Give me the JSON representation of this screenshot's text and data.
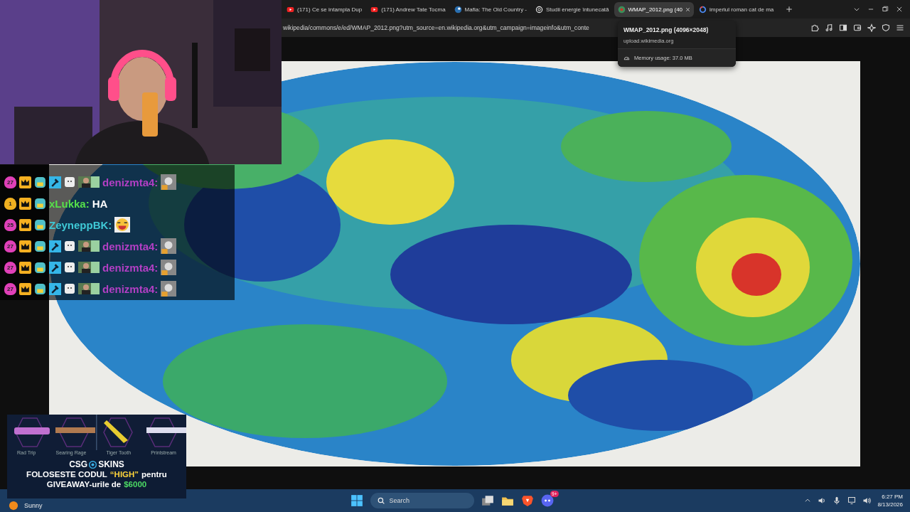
{
  "browser": {
    "tabs": [
      {
        "title": "(171) Ce se intampla Dup",
        "kind": "youtube",
        "selected": false
      },
      {
        "title": "(171) Andrew Tate Tocma",
        "kind": "youtube",
        "selected": false
      },
      {
        "title": "Mafia: The Old Country -",
        "kind": "steam",
        "selected": false
      },
      {
        "title": "Studii energie întunecată",
        "kind": "chat",
        "selected": false
      },
      {
        "title": "WMAP_2012.png (40",
        "kind": "wiki",
        "selected": true
      },
      {
        "title": "imperiul roman cat de ma",
        "kind": "google",
        "selected": false
      }
    ],
    "address": "wikipedia/commons/e/ed/WMAP_2012.png?utm_source=en.wikipedia.org&utm_campaign=imageinfo&utm_conte",
    "tooltip": {
      "title": "WMAP_2012.png (4096×2048)",
      "host": "upload.wikimedia.org",
      "memory": "Memory usage: 37.0 MB"
    }
  },
  "chat": [
    {
      "kind": "mod",
      "badge": {
        "text": "27",
        "color": "#e040b8"
      },
      "name": "denizmta4:",
      "color": "#b23fc4"
    },
    {
      "kind": "viewer",
      "badge": {
        "text": "1",
        "color": "#f0b020"
      },
      "name": "xLukka:",
      "color": "#56e04a",
      "message": "HA"
    },
    {
      "kind": "viewer",
      "badge": {
        "text": "25",
        "color": "#e040b8"
      },
      "name": "ZeyneppBK:",
      "color": "#3fc9d6"
    },
    {
      "kind": "mod",
      "badge": {
        "text": "27",
        "color": "#e040b8"
      },
      "name": "denizmta4:",
      "color": "#b23fc4"
    },
    {
      "kind": "mod",
      "badge": {
        "text": "27",
        "color": "#e040b8"
      },
      "name": "denizmta4:",
      "color": "#b23fc4"
    },
    {
      "kind": "mod",
      "badge": {
        "text": "27",
        "color": "#e040b8"
      },
      "name": "denizmta4:",
      "color": "#b23fc4"
    }
  ],
  "promo": {
    "labels": [
      "Rad Trip",
      "Searing Rage",
      "Tiger Tooth",
      "Printstream"
    ],
    "brand": [
      "CSG",
      "SKINS"
    ],
    "lines": [
      [
        {
          "text": "FOLOSESTE CODUL",
          "color": "#ffffff"
        },
        {
          "text": "“HIGH”",
          "color": "#ffd43b"
        },
        {
          "text": "pentru",
          "color": "#ffffff"
        }
      ],
      [
        {
          "text": "GIVEAWAY-urile de",
          "color": "#ffffff"
        },
        {
          "text": "$6000",
          "color": "#4cd964"
        }
      ]
    ]
  },
  "taskbar": {
    "weather": "Sunny",
    "search_placeholder": "Search",
    "discord_badge": "9+",
    "time": "6:27 PM",
    "date": "8/13/2026"
  }
}
